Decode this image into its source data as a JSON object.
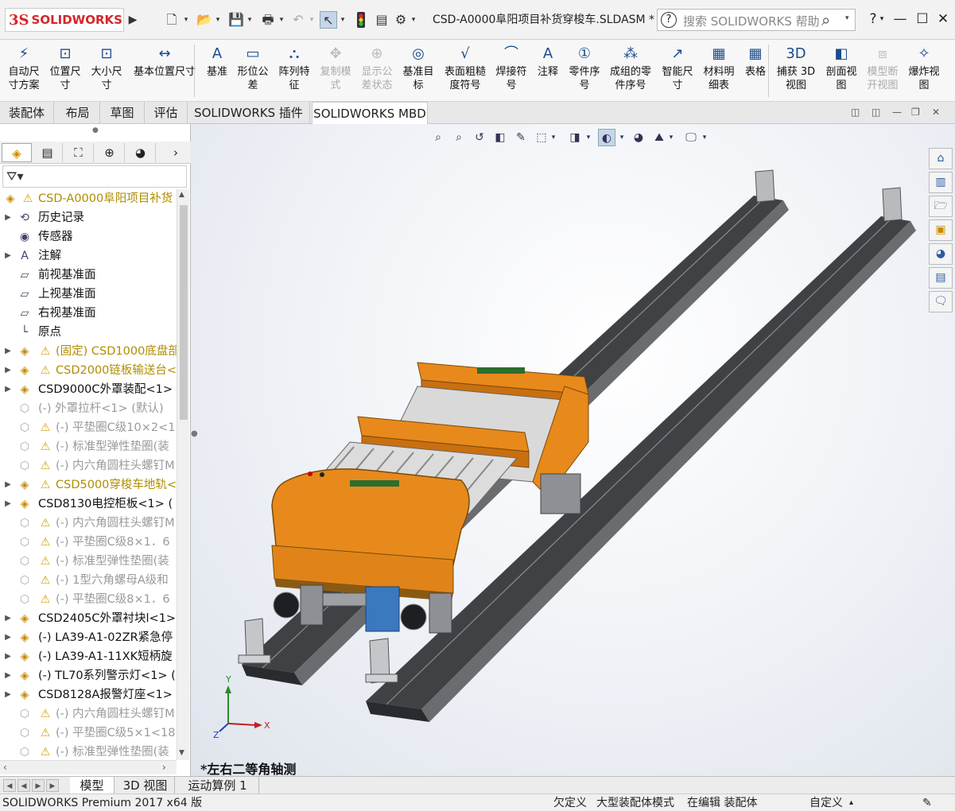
{
  "app": {
    "logo_ds": "3S",
    "logo_text": "SOLIDWORKS",
    "document_title": "CSD-A0000阜阳项目补货穿梭车.SLDASM *",
    "search_placeholder": "搜索 SOLIDWORKS 帮助",
    "help_label": "?"
  },
  "ribbon": [
    {
      "label": "自动尺\n寸方案",
      "icon": "⚡",
      "enabled": true
    },
    {
      "label": "位置尺\n寸",
      "icon": "⊡",
      "enabled": true
    },
    {
      "label": "大小尺\n寸",
      "icon": "⊡",
      "enabled": true
    },
    {
      "label": "基本位置尺寸",
      "icon": "↔",
      "enabled": true
    },
    {
      "label": "基准",
      "icon": "A",
      "enabled": true
    },
    {
      "label": "形位公\n差",
      "icon": "▭",
      "enabled": true
    },
    {
      "label": "阵列特\n征",
      "icon": "⛬",
      "enabled": true
    },
    {
      "label": "复制模\n式",
      "icon": "✥",
      "enabled": false
    },
    {
      "label": "显示公\n差状态",
      "icon": "⊕",
      "enabled": false
    },
    {
      "label": "基准目\n标",
      "icon": "◎",
      "enabled": true
    },
    {
      "label": "表面粗糙\n度符号",
      "icon": "√",
      "enabled": true
    },
    {
      "label": "焊接符\n号",
      "icon": "⌒",
      "enabled": true
    },
    {
      "label": "注释",
      "icon": "A",
      "enabled": true
    },
    {
      "label": "零件序\n号",
      "icon": "①",
      "enabled": true
    },
    {
      "label": "成组的零\n件序号",
      "icon": "⁂",
      "enabled": true
    },
    {
      "label": "智能尺\n寸",
      "icon": "↗",
      "enabled": true
    },
    {
      "label": "材料明\n细表",
      "icon": "▦",
      "enabled": true
    },
    {
      "label": "表格",
      "icon": "▦",
      "enabled": true
    },
    {
      "label": "捕获 3D\n视图",
      "icon": "3D",
      "enabled": true
    },
    {
      "label": "剖面视\n图",
      "icon": "◧",
      "enabled": true
    },
    {
      "label": "模型断\n开视图",
      "icon": "⧈",
      "enabled": false
    },
    {
      "label": "爆炸视\n图",
      "icon": "✧",
      "enabled": true
    }
  ],
  "tabs": [
    "装配体",
    "布局",
    "草图",
    "评估",
    "SOLIDWORKS 插件",
    "SOLIDWORKS MBD"
  ],
  "tree": [
    {
      "label": "CSD-A0000阜阳项目补货",
      "style": "yel",
      "exp": "",
      "icon": "◈",
      "warn": true,
      "indent": 0
    },
    {
      "label": "历史记录",
      "style": "norm",
      "exp": "▶",
      "icon": "⟲",
      "warn": false,
      "indent": 1
    },
    {
      "label": "传感器",
      "style": "norm",
      "exp": "",
      "icon": "◉",
      "warn": false,
      "indent": 1
    },
    {
      "label": "注解",
      "style": "norm",
      "exp": "▶",
      "icon": "A",
      "warn": false,
      "indent": 1
    },
    {
      "label": "前视基准面",
      "style": "norm",
      "exp": "",
      "icon": "▱",
      "warn": false,
      "indent": 1
    },
    {
      "label": "上视基准面",
      "style": "norm",
      "exp": "",
      "icon": "▱",
      "warn": false,
      "indent": 1
    },
    {
      "label": "右视基准面",
      "style": "norm",
      "exp": "",
      "icon": "▱",
      "warn": false,
      "indent": 1
    },
    {
      "label": "原点",
      "style": "norm",
      "exp": "",
      "icon": "└",
      "warn": false,
      "indent": 1
    },
    {
      "label": "(固定) CSD1000底盘部",
      "style": "yel",
      "exp": "▶",
      "icon": "◈",
      "warn": true,
      "indent": 1
    },
    {
      "label": "CSD2000链板输送台<",
      "style": "yel",
      "exp": "▶",
      "icon": "◈",
      "warn": true,
      "indent": 1
    },
    {
      "label": "CSD9000C外罩装配<1>",
      "style": "norm",
      "exp": "▶",
      "icon": "◈",
      "warn": false,
      "indent": 1
    },
    {
      "label": "(-) 外罩拉杆<1> (默认)",
      "style": "gray",
      "exp": "",
      "icon": "⬡",
      "warn": false,
      "indent": 1
    },
    {
      "label": "(-) 平垫圈C级10×2<1",
      "style": "gray",
      "exp": "",
      "icon": "⬡",
      "warn": true,
      "indent": 1
    },
    {
      "label": "(-) 标准型弹性垫圈(装",
      "style": "gray",
      "exp": "",
      "icon": "⬡",
      "warn": true,
      "indent": 1
    },
    {
      "label": "(-) 内六角圆柱头螺钉M",
      "style": "gray",
      "exp": "",
      "icon": "⬡",
      "warn": true,
      "indent": 1
    },
    {
      "label": "CSD5000穿梭车地轨<",
      "style": "yel",
      "exp": "▶",
      "icon": "◈",
      "warn": true,
      "indent": 1
    },
    {
      "label": "CSD8130电控柜板<1> (",
      "style": "norm",
      "exp": "▶",
      "icon": "◈",
      "warn": false,
      "indent": 1
    },
    {
      "label": "(-) 内六角圆柱头螺钉M",
      "style": "gray",
      "exp": "",
      "icon": "⬡",
      "warn": true,
      "indent": 1
    },
    {
      "label": "(-) 平垫圈C级8×1．6",
      "style": "gray",
      "exp": "",
      "icon": "⬡",
      "warn": true,
      "indent": 1
    },
    {
      "label": "(-) 标准型弹性垫圈(装",
      "style": "gray",
      "exp": "",
      "icon": "⬡",
      "warn": true,
      "indent": 1
    },
    {
      "label": "(-) 1型六角螺母A级和",
      "style": "gray",
      "exp": "",
      "icon": "⬡",
      "warn": true,
      "indent": 1
    },
    {
      "label": "(-) 平垫圈C级8×1．6",
      "style": "gray",
      "exp": "",
      "icon": "⬡",
      "warn": true,
      "indent": 1
    },
    {
      "label": "CSD2405C外罩衬块l<1>",
      "style": "norm",
      "exp": "▶",
      "icon": "◈",
      "warn": false,
      "indent": 1
    },
    {
      "label": "(-) LA39-A1-02ZR紧急停",
      "style": "norm",
      "exp": "▶",
      "icon": "◈",
      "warn": false,
      "indent": 1
    },
    {
      "label": "(-) LA39-A1-11XK短柄旋",
      "style": "norm",
      "exp": "▶",
      "icon": "◈",
      "warn": false,
      "indent": 1
    },
    {
      "label": "(-) TL70系列警示灯<1> (",
      "style": "norm",
      "exp": "▶",
      "icon": "◈",
      "warn": false,
      "indent": 1
    },
    {
      "label": "CSD8128A报警灯座<1>",
      "style": "norm",
      "exp": "▶",
      "icon": "◈",
      "warn": false,
      "indent": 1
    },
    {
      "label": "(-) 内六角圆柱头螺钉M",
      "style": "gray",
      "exp": "",
      "icon": "⬡",
      "warn": true,
      "indent": 1
    },
    {
      "label": "(-) 平垫圈C级5×1<18",
      "style": "gray",
      "exp": "",
      "icon": "⬡",
      "warn": true,
      "indent": 1
    },
    {
      "label": "(-) 标准型弹性垫圈(装",
      "style": "gray",
      "exp": "",
      "icon": "⬡",
      "warn": true,
      "indent": 1
    }
  ],
  "viewport": {
    "view_label": "*左右二等角轴测",
    "axis_x": "X",
    "axis_y": "Y",
    "axis_z": "Z"
  },
  "bottom_tabs": [
    "模型",
    "3D 视图",
    "运动算例 1"
  ],
  "status": {
    "version": "SOLIDWORKS Premium 2017 x64 版",
    "s1": "欠定义",
    "s2": "大型装配体模式",
    "s3": "在编辑 装配体",
    "s4": "自定义"
  },
  "colors": {
    "orange": "#e8891c",
    "rail": "#3f4145",
    "brand_red": "#d4262a"
  }
}
